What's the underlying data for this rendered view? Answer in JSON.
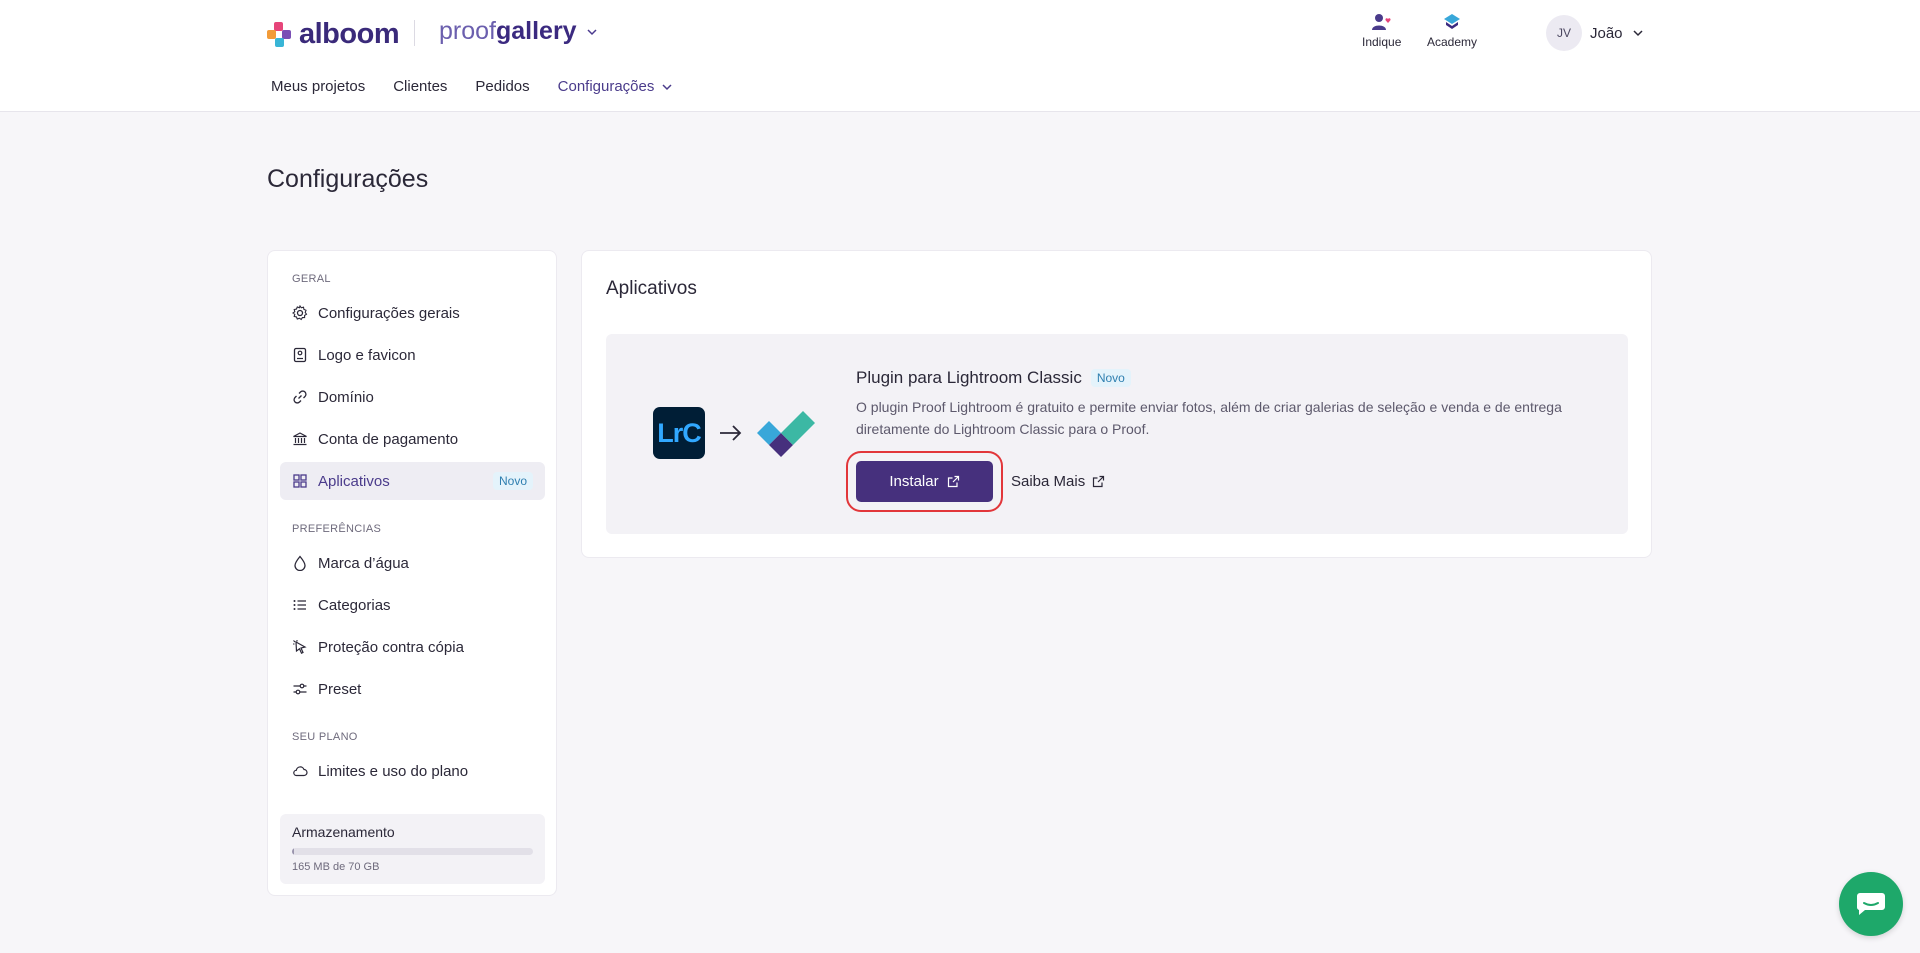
{
  "header": {
    "logo_text": "alboom",
    "product_name_light": "proof",
    "product_name_bold": "gallery",
    "nav": [
      "Meus projetos",
      "Clientes",
      "Pedidos",
      "Configurações"
    ],
    "indique_label": "Indique",
    "academy_label": "Academy",
    "user_initials": "JV",
    "user_name": "João"
  },
  "page_title": "Configurações",
  "sidebar": {
    "sections": {
      "geral": "GERAL",
      "preferencias": "PREFERÊNCIAS",
      "seu_plano": "SEU PLANO"
    },
    "items": [
      {
        "label": "Configurações gerais",
        "icon": "gear-icon"
      },
      {
        "label": "Logo e favicon",
        "icon": "image-frame-icon"
      },
      {
        "label": "Domínio",
        "icon": "link-icon"
      },
      {
        "label": "Conta de pagamento",
        "icon": "bank-icon"
      },
      {
        "label": "Aplicativos",
        "icon": "grid-icon",
        "badge": "Novo",
        "active": true
      },
      {
        "label": "Marca d’água",
        "icon": "droplet-icon"
      },
      {
        "label": "Categorias",
        "icon": "list-icon"
      },
      {
        "label": "Proteção contra cópia",
        "icon": "cursor-icon"
      },
      {
        "label": "Preset",
        "icon": "sliders-icon"
      },
      {
        "label": "Limites e uso do plano",
        "icon": "cloud-icon"
      }
    ],
    "storage": {
      "title": "Armazenamento",
      "usage_text": "165 MB de 70 GB",
      "used_fraction": 0.0023
    }
  },
  "main": {
    "title": "Aplicativos",
    "app": {
      "name": "Plugin para Lightroom Classic",
      "badge": "Novo",
      "lrc_label": "LrC",
      "description": "O plugin Proof Lightroom é gratuito e permite enviar fotos, além de criar galerias de seleção e venda e de entrega diretamente do Lightroom Classic para o Proof.",
      "install_label": "Instalar",
      "more_label": "Saiba Mais"
    }
  },
  "colors": {
    "accent": "#46307d",
    "highlight_outline": "#e2363a",
    "badge_text": "#2e7fb0",
    "chat": "#1ea86a"
  }
}
